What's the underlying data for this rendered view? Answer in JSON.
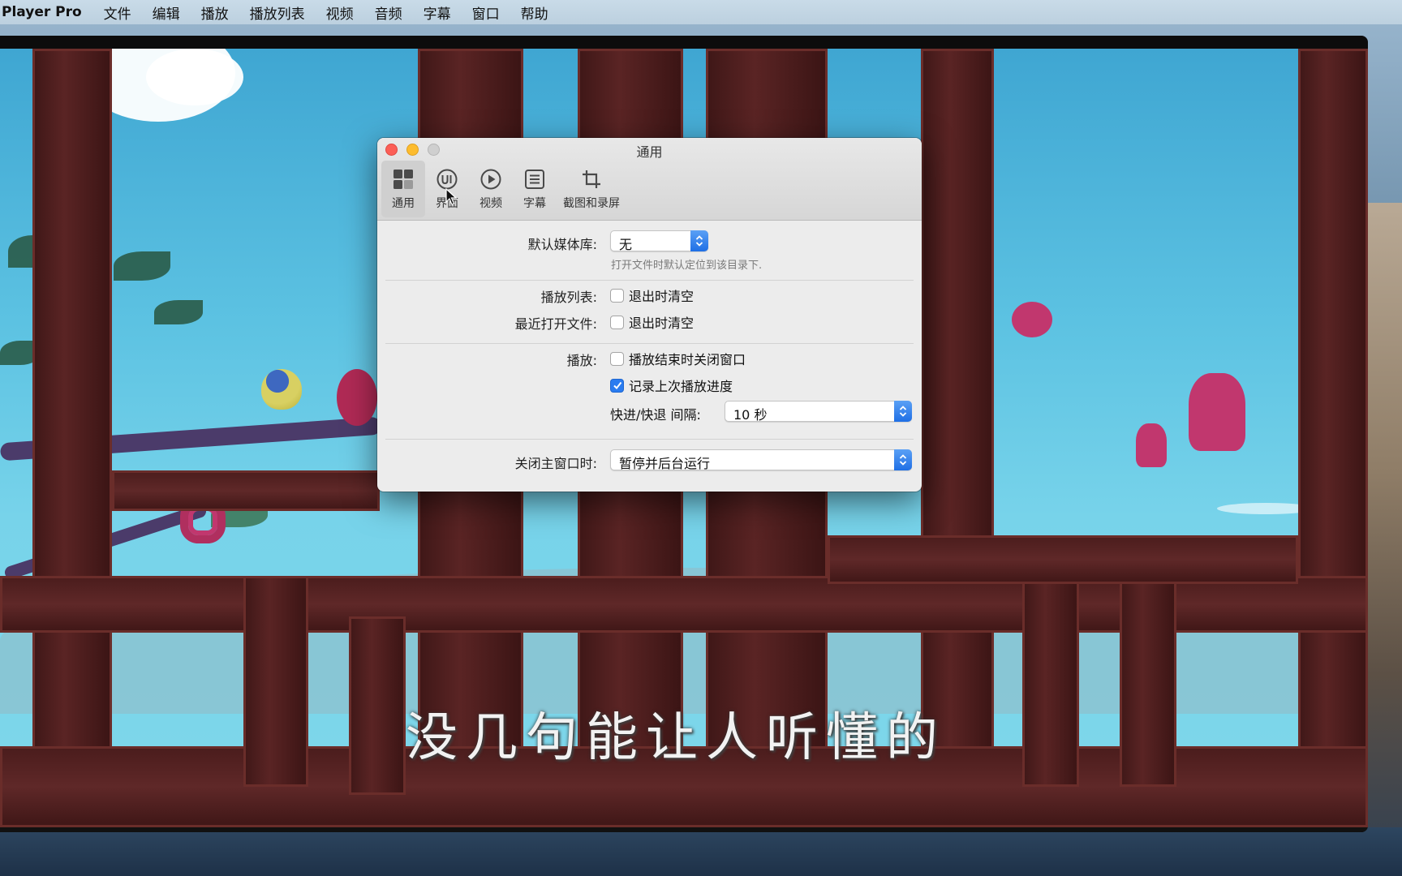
{
  "menubar": {
    "app_name": "Player Pro",
    "items": [
      "文件",
      "编辑",
      "播放",
      "播放列表",
      "视频",
      "音频",
      "字幕",
      "窗口",
      "帮助"
    ]
  },
  "video": {
    "subtitle": "没几句能让人听懂的"
  },
  "prefs": {
    "title": "通用",
    "toolbar": [
      {
        "label": "通用",
        "icon": "grid-icon",
        "active": true
      },
      {
        "label": "界面",
        "icon": "ui-icon",
        "active": false
      },
      {
        "label": "视频",
        "icon": "play-circle-icon",
        "active": false
      },
      {
        "label": "字幕",
        "icon": "subtitle-list-icon",
        "active": false
      },
      {
        "label": "截图和录屏",
        "icon": "crop-icon",
        "active": false
      }
    ],
    "media_library": {
      "label": "默认媒体库:",
      "value": "无",
      "hint": "打开文件时默认定位到该目录下."
    },
    "playlist": {
      "label": "播放列表:",
      "checkbox_label": "退出时清空",
      "checked": false
    },
    "recent_files": {
      "label": "最近打开文件:",
      "checkbox_label": "退出时清空",
      "checked": false
    },
    "playback": {
      "label": "播放:",
      "close_on_end_label": "播放结束时关闭窗口",
      "close_on_end_checked": false,
      "remember_progress_label": "记录上次播放进度",
      "remember_progress_checked": true,
      "seek_interval_label": "快进/快退 间隔:",
      "seek_interval_value": "10 秒"
    },
    "close_main": {
      "label": "关闭主窗口时:",
      "value": "暂停并后台运行"
    }
  },
  "colors": {
    "accent": "#2a7cf0",
    "close": "#fc5f57",
    "minimize": "#fdbc2e",
    "zoom_disabled": "#cfcfcf"
  }
}
